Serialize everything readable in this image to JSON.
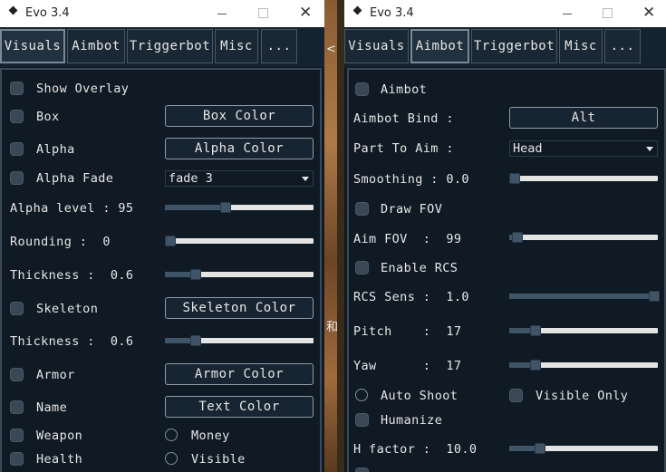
{
  "colors": {
    "window_bg": "#0f1a25",
    "slider_track": "#e4e4e4",
    "slider_fill": "#3f5467",
    "button_border": "#8e9ba6"
  },
  "windows": [
    {
      "title": "Evo 3.4",
      "tabs": [
        {
          "label": "Visuals",
          "active": true
        },
        {
          "label": "Aimbot",
          "active": false
        },
        {
          "label": "Triggerbot",
          "active": false
        },
        {
          "label": "Misc",
          "active": false
        },
        {
          "label": "...",
          "active": false
        }
      ],
      "visuals": {
        "show_overlay": "Show Overlay",
        "box": "Box",
        "box_color": "Box Color",
        "alpha": "Alpha",
        "alpha_color": "Alpha Color",
        "alpha_fade": "Alpha Fade",
        "alpha_fade_value": "fade 3",
        "alpha_level": "Alpha level : 95",
        "alpha_level_pct": 0.4,
        "rounding": "Rounding :  0",
        "rounding_pct": 0.0,
        "thickness1": "Thickness :  0.6",
        "thickness1_pct": 0.2,
        "skeleton": "Skeleton",
        "skeleton_color": "Skeleton Color",
        "thickness2": "Thickness :  0.6",
        "thickness2_pct": 0.2,
        "armor": "Armor",
        "armor_color": "Armor Color",
        "name": "Name",
        "text_color": "Text Color",
        "weapon": "Weapon",
        "money": "Money",
        "health": "Health",
        "visible": "Visible"
      }
    },
    {
      "title": "Evo 3.4",
      "tabs": [
        {
          "label": "Visuals",
          "active": false
        },
        {
          "label": "Aimbot",
          "active": true
        },
        {
          "label": "Triggerbot",
          "active": false
        },
        {
          "label": "Misc",
          "active": false
        },
        {
          "label": "...",
          "active": false
        }
      ],
      "aimbot": {
        "aimbot": "Aimbot",
        "aimbot_bind_label": "Aimbot Bind :",
        "aimbot_bind_value": "Alt",
        "part_to_aim_label": "Part To Aim :",
        "part_to_aim_value": "Head",
        "smoothing": "Smoothing : 0.0",
        "smoothing_pct": 0.0,
        "draw_fov": "Draw FOV",
        "aim_fov": "Aim FOV  :  99",
        "aim_fov_pct": 0.05,
        "enable_rcs": "Enable RCS",
        "rcs_sens": "RCS Sens :  1.0",
        "rcs_sens_pct": 1.0,
        "pitch": "Pitch    :  17",
        "pitch_pct": 0.17,
        "yaw": "Yaw      :  17",
        "yaw_pct": 0.17,
        "auto_shoot": "Auto Shoot",
        "visible_only": "Visible Only",
        "humanize": "Humanize",
        "h_factor": "H factor :  10.0",
        "h_factor_pct": 0.2
      }
    }
  ],
  "background_marks": [
    "<",
    "和"
  ]
}
